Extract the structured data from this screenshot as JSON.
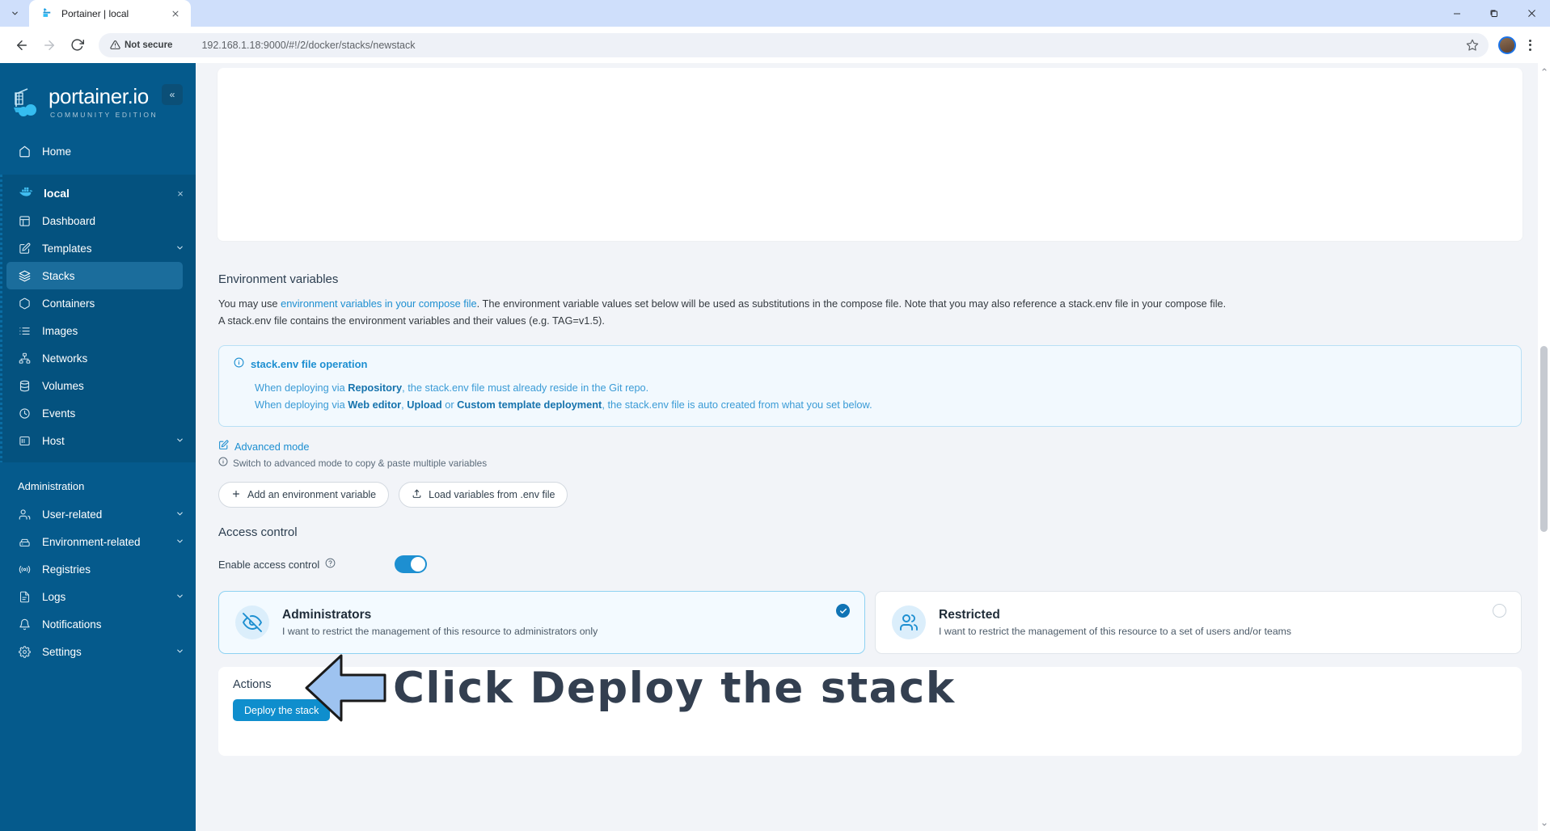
{
  "browser": {
    "tab_title": "Portainer | local",
    "tab_list_icon": "chevron-down-icon",
    "close_icon": "close-icon",
    "back_icon": "arrow-left-icon",
    "forward_icon": "arrow-right-icon",
    "reload_icon": "reload-icon",
    "security_label": "Not secure",
    "url": "192.168.1.18:9000/#!/2/docker/stacks/newstack",
    "bookmark_icon": "star-icon",
    "minimize_label": "—",
    "maximize_label": "❐",
    "close_label": "✕"
  },
  "sidebar": {
    "logo_title": "portainer.io",
    "logo_subtitle": "COMMUNITY EDITION",
    "collapse_label": "«",
    "home_label": "Home",
    "environment": {
      "name": "local",
      "close_label": "×",
      "items": [
        {
          "label": "Dashboard",
          "icon": "dashboard-icon",
          "chevron": ""
        },
        {
          "label": "Templates",
          "icon": "templates-icon",
          "chevron": "❯"
        },
        {
          "label": "Stacks",
          "icon": "stacks-icon",
          "chevron": ""
        },
        {
          "label": "Containers",
          "icon": "containers-icon",
          "chevron": ""
        },
        {
          "label": "Images",
          "icon": "images-icon",
          "chevron": ""
        },
        {
          "label": "Networks",
          "icon": "networks-icon",
          "chevron": ""
        },
        {
          "label": "Volumes",
          "icon": "volumes-icon",
          "chevron": ""
        },
        {
          "label": "Events",
          "icon": "events-icon",
          "chevron": ""
        },
        {
          "label": "Host",
          "icon": "host-icon",
          "chevron": "❯"
        }
      ]
    },
    "administration_label": "Administration",
    "admin_items": [
      {
        "label": "User-related",
        "icon": "users-icon",
        "chevron": "❯"
      },
      {
        "label": "Environment-related",
        "icon": "environment-icon",
        "chevron": "❯"
      },
      {
        "label": "Registries",
        "icon": "registries-icon",
        "chevron": ""
      },
      {
        "label": "Logs",
        "icon": "logs-icon",
        "chevron": "❯"
      },
      {
        "label": "Notifications",
        "icon": "bell-icon",
        "chevron": ""
      },
      {
        "label": "Settings",
        "icon": "gear-icon",
        "chevron": "❯"
      }
    ]
  },
  "main": {
    "env_vars": {
      "title": "Environment variables",
      "para_1": "You may use ",
      "para_link": "environment variables in your compose file",
      "para_2": ". The environment variable values set below will be used as substitutions in the compose file. Note that you may also reference a stack.env file in your compose file. A stack.env file contains the environment variables and their values (e.g. TAG=v1.5)."
    },
    "infobox": {
      "icon": "info-icon",
      "title": "stack.env file operation",
      "line1_a": "When deploying via ",
      "line1_b": "Repository",
      "line1_c": ", the stack.env file must already reside in the Git repo.",
      "line2_a": "When deploying via ",
      "line2_b": "Web editor",
      "line2_c": ", ",
      "line2_d": "Upload",
      "line2_e": " or ",
      "line2_f": "Custom template deployment",
      "line2_g": ", the stack.env file is auto created from what you set below."
    },
    "advanced_mode": {
      "label": "Advanced mode",
      "icon": "edit-icon",
      "hint": "Switch to advanced mode to copy & paste multiple variables",
      "hint_icon": "info-icon"
    },
    "buttons": {
      "add_env_var": "Add an environment variable",
      "add_env_var_icon": "plus-icon",
      "load_env": "Load variables from .env file",
      "load_env_icon": "upload-icon"
    },
    "access_control": {
      "title": "Access control",
      "toggle_label": "Enable access control",
      "toggle_help_icon": "question-icon",
      "toggle_on": true,
      "options": [
        {
          "title": "Administrators",
          "desc": "I want to restrict the management of this resource to administrators only",
          "icon": "eye-off-icon",
          "selected": true
        },
        {
          "title": "Restricted",
          "desc": "I want to restrict the management of this resource to a set of users and/or teams",
          "icon": "users-group-icon",
          "selected": false
        }
      ]
    },
    "actions": {
      "title": "Actions",
      "deploy_label": "Deploy the stack"
    },
    "annotation": {
      "text": "Click Deploy the stack",
      "arrow_icon": "arrow-left-annotation",
      "arrow_fill": "#9ec3f0",
      "arrow_stroke": "#1a1a1a",
      "text_color": "#333f50"
    }
  },
  "colors": {
    "sidebar_bg": "#055a8c",
    "accent": "#1d8fd1",
    "deploy_btn": "#0f8ecd",
    "content_bg": "#f2f4f8"
  }
}
